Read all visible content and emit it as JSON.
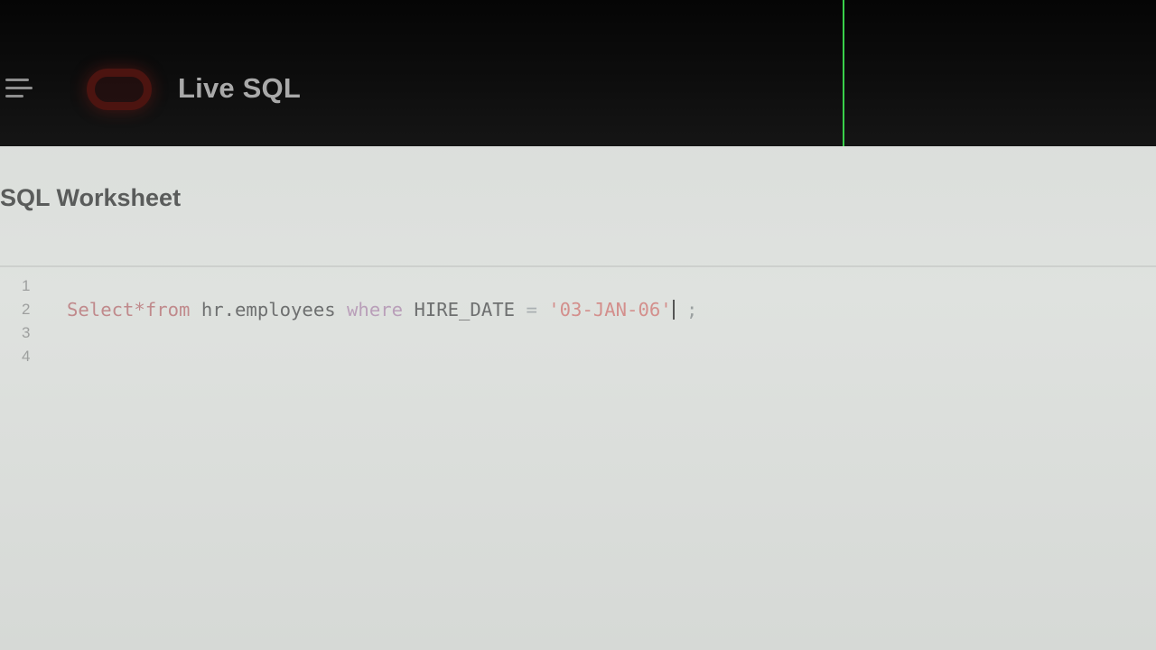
{
  "header": {
    "menu_icon": "hamburger-menu-icon",
    "logo_icon": "oracle-logo-icon",
    "title": "Live SQL"
  },
  "page": {
    "title": "SQL Worksheet"
  },
  "editor": {
    "line_numbers": [
      "1",
      "2",
      "3",
      "4"
    ],
    "line_2_tokens": {
      "select_kw": "Select",
      "star": "*",
      "from_kw": "from",
      "space1": " ",
      "table": "hr.employees",
      "space2": " ",
      "where_kw": "where",
      "space3": " ",
      "column": "HIRE_DATE",
      "space4": " ",
      "equals": "=",
      "space5": " ",
      "string": "'03-JAN-06'",
      "space6": " ",
      "semicolon": ";"
    }
  },
  "colors": {
    "header_bg": "#0e0e0e",
    "header_title": "#a9a9a9",
    "page_bg": "#dcdfdc",
    "keyword": "#c08a8c",
    "string": "#d38f8c",
    "accent_line": "#39d04a"
  }
}
